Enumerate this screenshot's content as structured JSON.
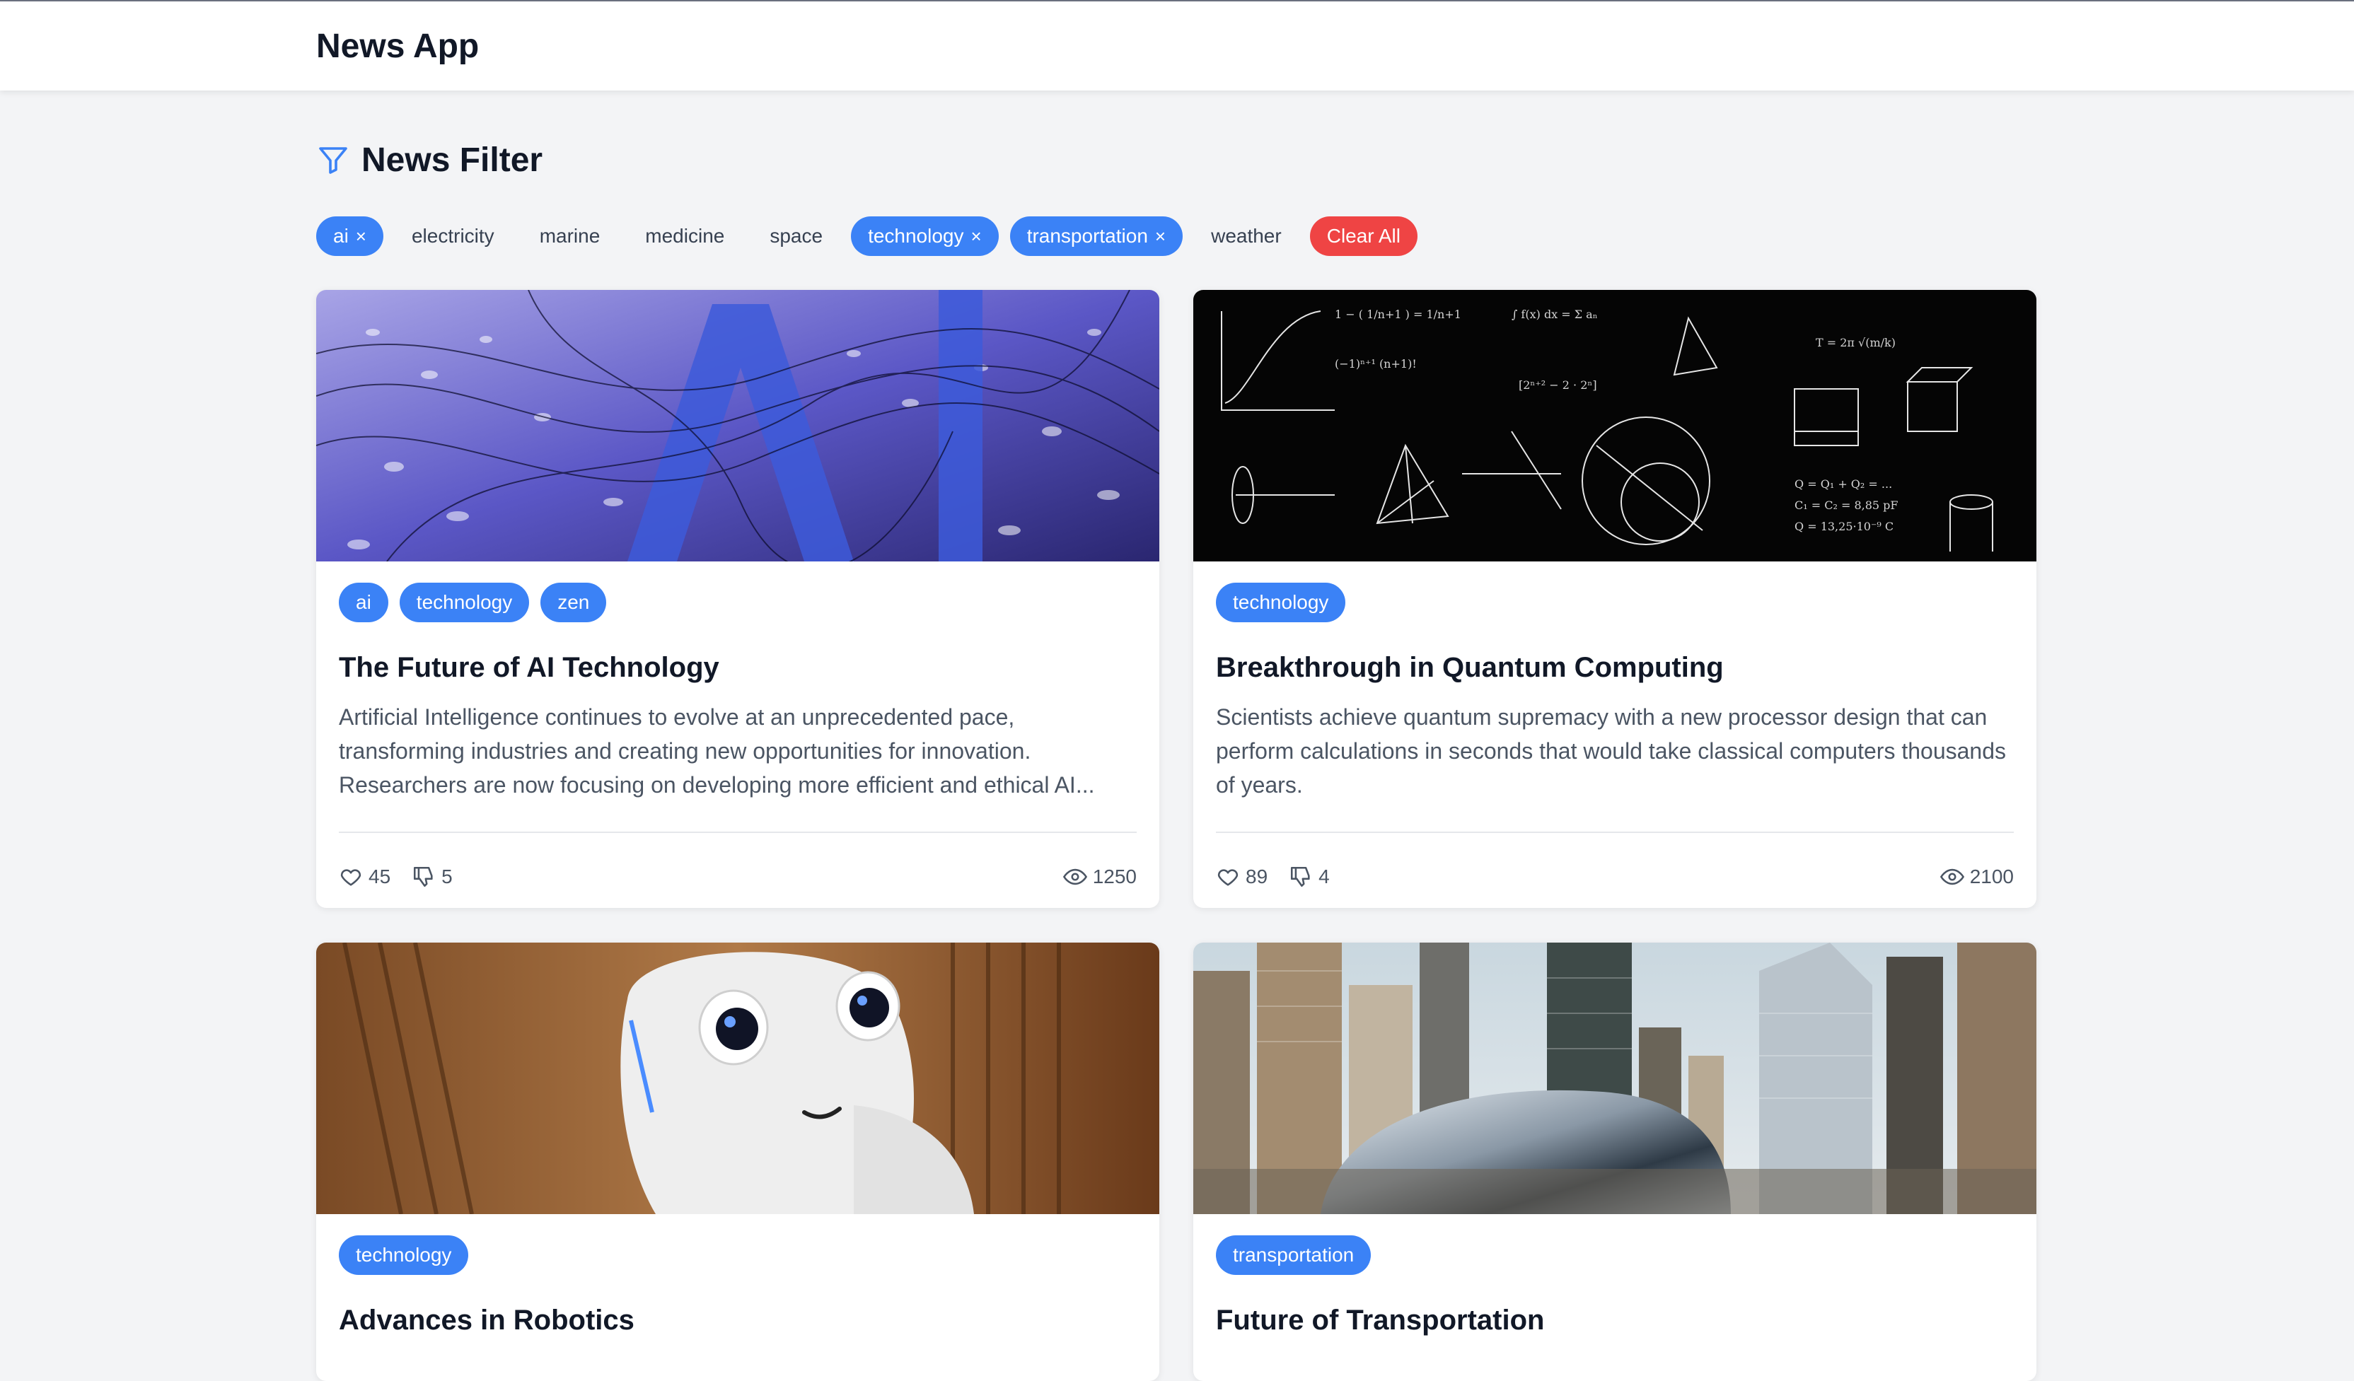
{
  "app": {
    "title": "News App"
  },
  "filter": {
    "title": "News Filter",
    "chips": [
      {
        "label": "ai",
        "active": true
      },
      {
        "label": "electricity",
        "active": false
      },
      {
        "label": "marine",
        "active": false
      },
      {
        "label": "medicine",
        "active": false
      },
      {
        "label": "space",
        "active": false
      },
      {
        "label": "technology",
        "active": true
      },
      {
        "label": "transportation",
        "active": true
      },
      {
        "label": "weather",
        "active": false
      }
    ],
    "clear_label": "Clear All",
    "remove_symbol": "×"
  },
  "articles": [
    {
      "tags": [
        "ai",
        "technology",
        "zen"
      ],
      "title": "The Future of AI Technology",
      "description": "Artificial Intelligence continues to evolve at an unprecedented pace, transforming industries and creating new opportunities for innovation. Researchers are now focusing on developing more efficient and ethical AI...",
      "likes": "45",
      "dislikes": "5",
      "views": "1250",
      "image": "ai-letters-image"
    },
    {
      "tags": [
        "technology"
      ],
      "title": "Breakthrough in Quantum Computing",
      "description": "Scientists achieve quantum supremacy with a new processor design that can perform calculations in seconds that would take classical computers thousands of years.",
      "likes": "89",
      "dislikes": "4",
      "views": "2100",
      "image": "chalkboard-formulas-image"
    },
    {
      "tags": [
        "technology"
      ],
      "title": "Advances in Robotics",
      "image": "robot-image"
    },
    {
      "tags": [
        "transportation"
      ],
      "title": "Future of Transportation",
      "image": "city-bean-image"
    }
  ],
  "colors": {
    "accent": "#3b82f6",
    "danger": "#ef4444",
    "background": "#f3f4f6"
  }
}
